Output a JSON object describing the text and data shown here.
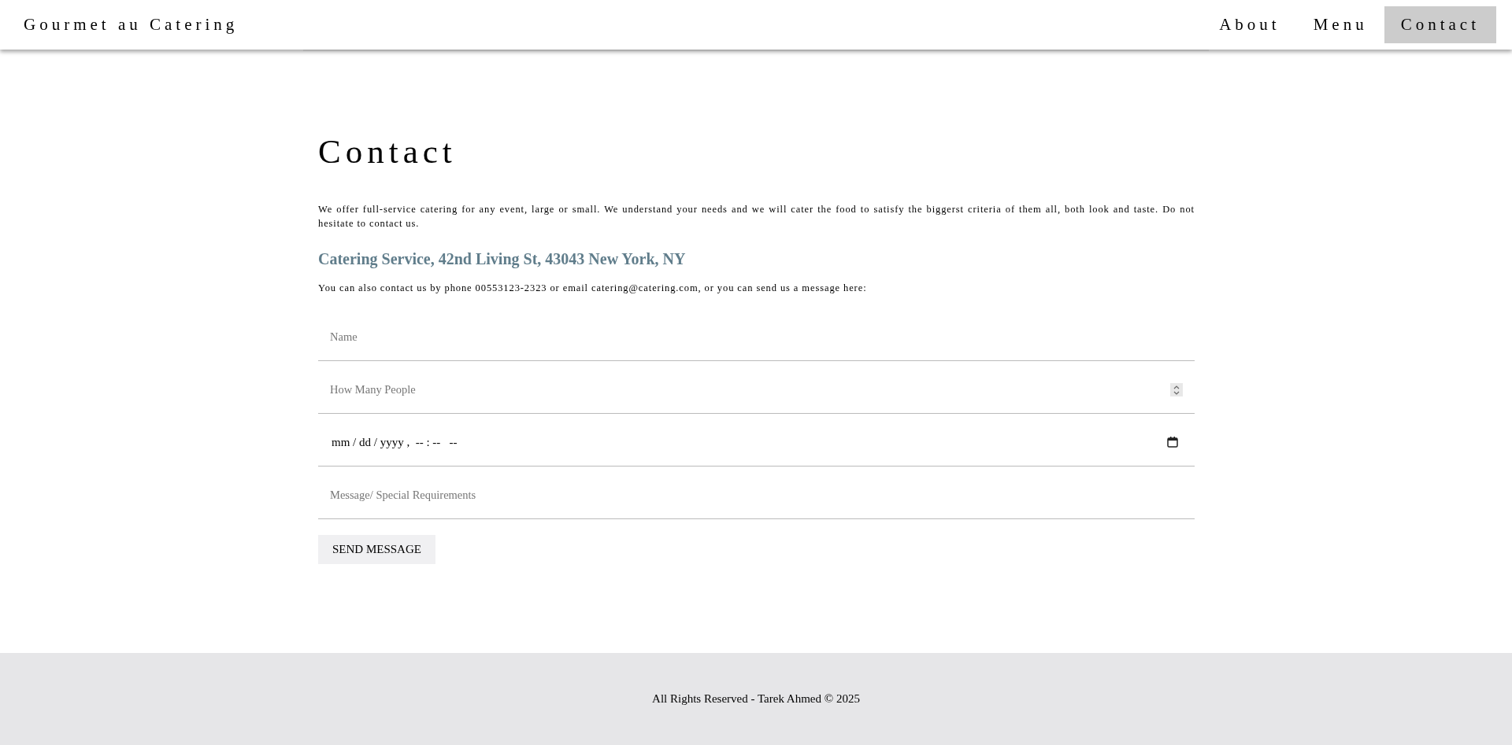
{
  "navbar": {
    "brand": "Gourmet au Catering",
    "links": [
      {
        "label": "About",
        "selected": false
      },
      {
        "label": "Menu",
        "selected": false
      },
      {
        "label": "Contact",
        "selected": true
      }
    ]
  },
  "heading": "Contact",
  "intro": "We offer full-service catering for any event, large or small. We understand your needs and we will cater the food to satisfy the biggerst criteria of them all, both look and taste. Do not hesitate to contact us.",
  "address": "Catering Service, 42nd Living St, 43043 New York, NY",
  "contact_line": "You can also contact us by phone 00553123-2323 or email catering@catering.com, or you can send us a message here:",
  "form": {
    "fields": [
      {
        "kind": "text",
        "placeholder": "Name"
      },
      {
        "kind": "number",
        "placeholder": "How Many People"
      },
      {
        "kind": "datetime",
        "value": "mm / dd / yyyy ,  -- : --   --"
      },
      {
        "kind": "text",
        "placeholder": "Message/ Special Requirements"
      }
    ],
    "submit": "SEND MESSAGE"
  },
  "footer": "All Rights Reserved - Tarek Ahmed © 2025"
}
